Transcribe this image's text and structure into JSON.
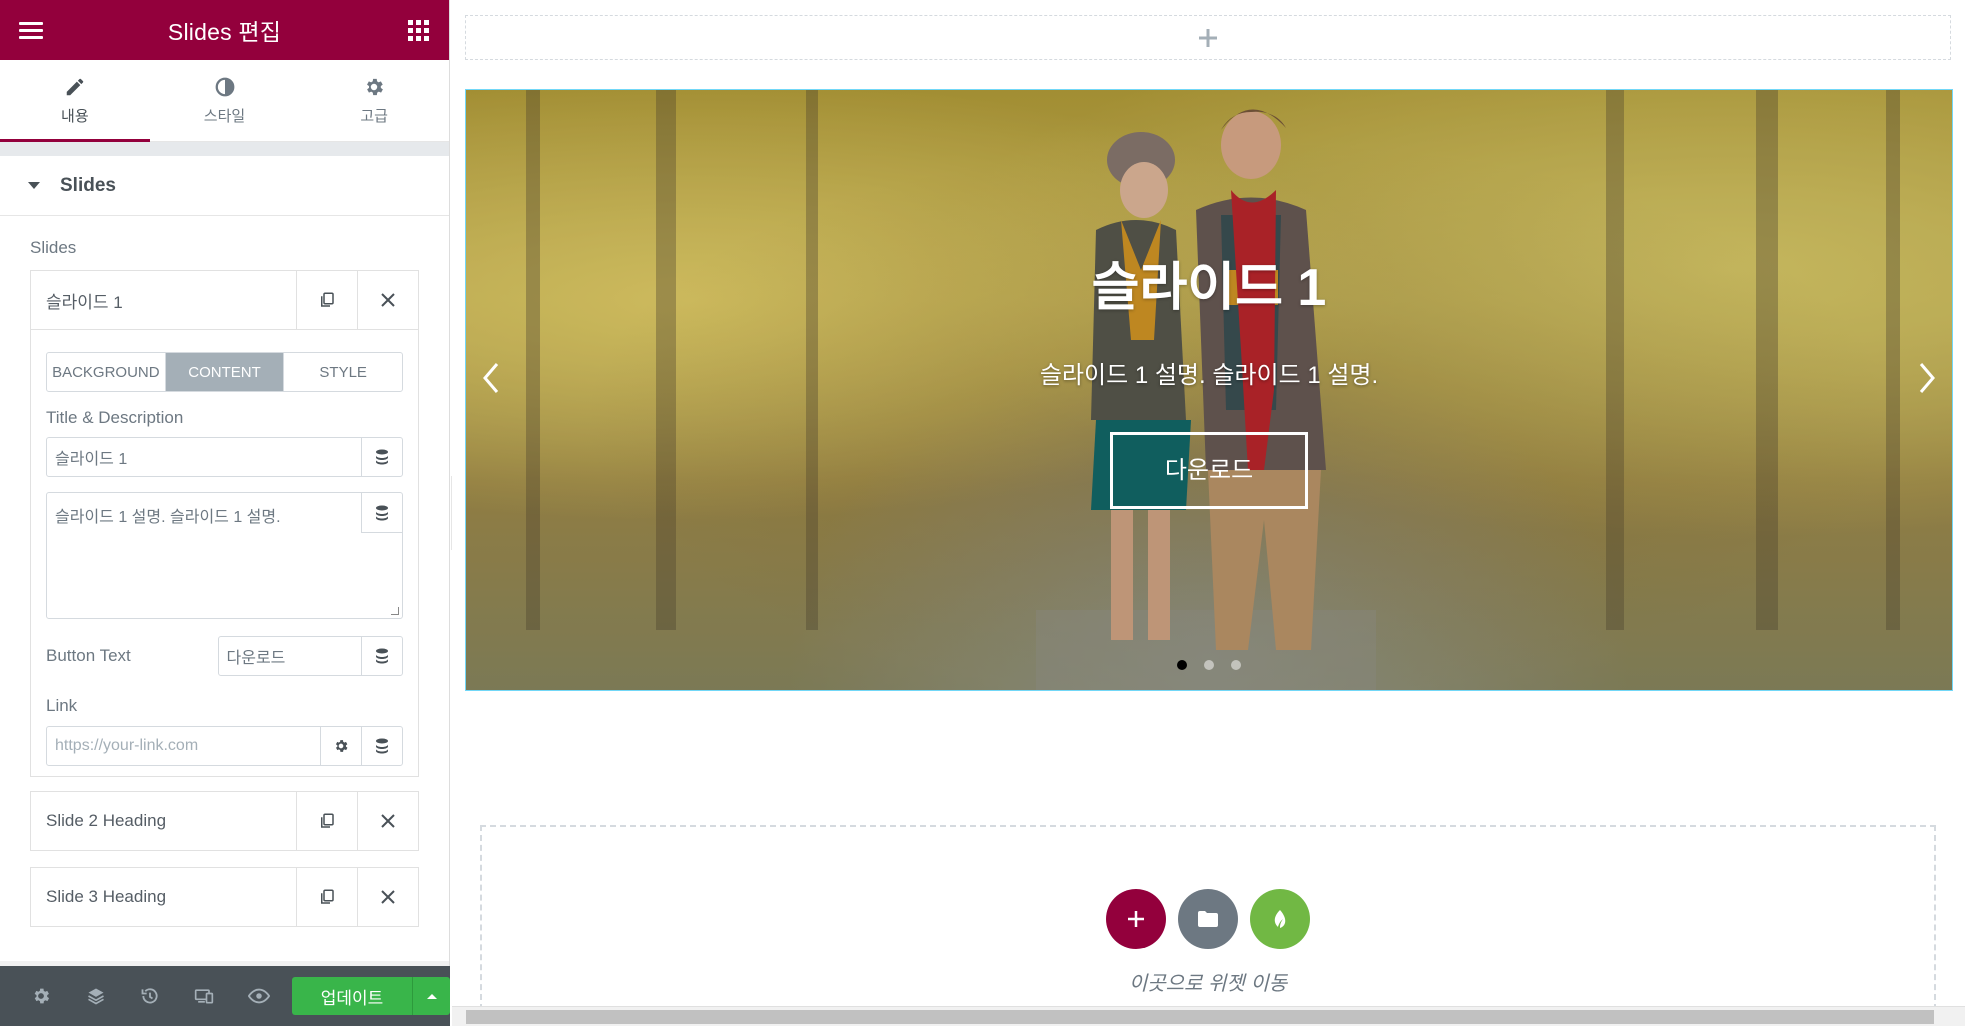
{
  "panel": {
    "title": "Slides 편집",
    "tabs": [
      {
        "label": "내용"
      },
      {
        "label": "스타일"
      },
      {
        "label": "고급"
      }
    ],
    "section_title": "Slides",
    "repeater_label": "Slides",
    "slides": [
      {
        "heading": "슬라이드 1"
      },
      {
        "heading": "Slide 2 Heading"
      },
      {
        "heading": "Slide 3 Heading"
      }
    ],
    "inner_tabs": [
      "BACKGROUND",
      "CONTENT",
      "STYLE"
    ],
    "title_desc_label": "Title & Description",
    "title_value": "슬라이드 1",
    "description_value": "슬라이드 1 설명. 슬라이드 1 설명.",
    "button_text_label": "Button Text",
    "button_text_value": "다운로드",
    "link_label": "Link",
    "link_placeholder": "https://your-link.com",
    "update_label": "업데이트"
  },
  "canvas": {
    "slide": {
      "title": "슬라이드 1",
      "description": "슬라이드 1 설명. 슬라이드 1 설명.",
      "button": "다운로드"
    },
    "dots_total": 3,
    "dots_active": 1,
    "dropzone_text": "이곳으로 위젯 이동"
  },
  "colors": {
    "brand": "#93003c",
    "update": "#39b54a",
    "accent_green": "#71b844",
    "folder_grey": "#6d7882"
  }
}
